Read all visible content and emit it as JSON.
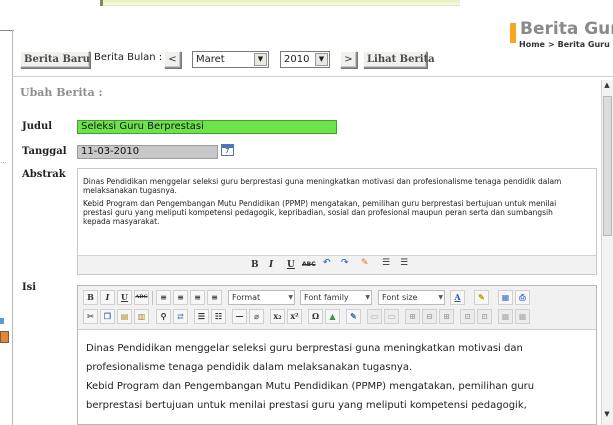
{
  "header": {
    "title": "Berita Guru",
    "breadcrumb": [
      "Home",
      ">",
      "Berita Guru"
    ],
    "accent": "#f6a623"
  },
  "toolbar": {
    "berita_baru": "Berita Baru",
    "bulan_label": "Berita Bulan :",
    "prev": "<",
    "month": "Maret",
    "year": "2010",
    "next": ">",
    "lihat": "Lihat Berita"
  },
  "form": {
    "section_title": "Ubah Berita :",
    "judul_label": "Judul",
    "judul_value": "Seleksi Guru Berprestasi",
    "tanggal_label": "Tanggal",
    "tanggal_value": "11-03-2010",
    "abstrak_label": "Abstrak",
    "abstrak_paragraphs": [
      "Dinas Pendidikan menggelar seleksi guru berprestasi guna meningkatkan motivasi dan profesionalisme tenaga pendidik dalam melaksanakan tugasnya.",
      "Kebid Program dan Pengembangan Mutu Pendidikan (PPMP) mengatakan, pemilihan guru berprestasi bertujuan untuk menilai prestasi guru yang meliputi kompetensi pedagogik, kepribadian, sosial dan profesional maupun peran serta dan sumbangsih kepada masyarakat."
    ],
    "isi_label": "Isi",
    "isi_lines": [
      "Dinas Pendidikan menggelar seleksi guru berprestasi guna meningkatkan motivasi dan",
      "profesionalisme tenaga pendidik dalam melaksanakan tugasnya.",
      "Kebid Program dan Pengembangan Mutu Pendidikan (PPMP) mengatakan, pemilihan guru",
      "berprestasi bertujuan untuk menilai prestasi guru yang meliputi kompetensi pedagogik,"
    ]
  },
  "editor": {
    "format": "Format",
    "font_family": "Font family",
    "font_size": "Font size"
  }
}
